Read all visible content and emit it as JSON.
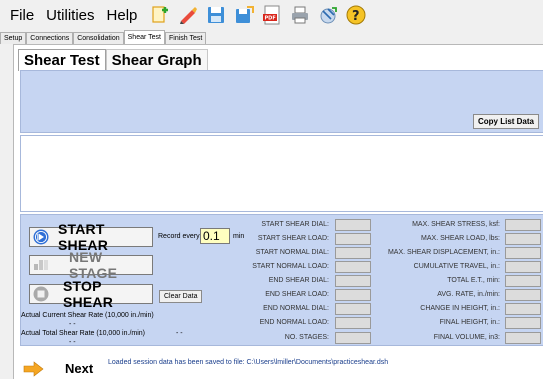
{
  "menu": {
    "items": [
      "File",
      "Utilities",
      "Help"
    ]
  },
  "toolbar_icons": [
    "new-icon",
    "edit-icon",
    "save-icon",
    "save-as-icon",
    "pdf-icon",
    "print-icon",
    "export-icon",
    "help-icon"
  ],
  "outer_tabs": [
    "Setup",
    "Connections",
    "Consolidation",
    "Shear Test",
    "Finish Test"
  ],
  "outer_active": "Shear Test",
  "inner_tabs": [
    "Shear Test",
    "Shear Graph"
  ],
  "copy_list_label": "Copy List Data",
  "controls": {
    "start_label": "START SHEAR",
    "new_stage_label": "NEW STAGE",
    "stop_label": "STOP SHEAR",
    "record_every_label": "Record every",
    "record_value": "0.1",
    "record_unit": "min",
    "clear_label": "Clear Data",
    "current_rate_label": "Actual Current Shear Rate (10,000 in./min)",
    "current_rate_value": "- -",
    "total_rate_label": "Actual Total Shear Rate (10,000 in./min)",
    "total_rate_value": "- -",
    "total_rate_value2": "- -"
  },
  "left_fields": [
    "START SHEAR DIAL:",
    "START SHEAR LOAD:",
    "START NORMAL DIAL:",
    "START NORMAL LOAD:",
    "END SHEAR DIAL:",
    "END SHEAR LOAD:",
    "END NORMAL DIAL:",
    "END NORMAL LOAD:",
    "NO. STAGES:"
  ],
  "right_fields": [
    "MAX. SHEAR STRESS, ksf:",
    "MAX. SHEAR LOAD, lbs:",
    "MAX. SHEAR DISPLACEMENT, in.:",
    "CUMULATIVE TRAVEL, in.:",
    "TOTAL E.T., min:",
    "AVG. RATE, in./min:",
    "CHANGE IN HEIGHT, in.:",
    "FINAL HEIGHT, in.:",
    "FINAL VOLUME, in3:"
  ],
  "next_label": "Next",
  "status_message": "Loaded session data has been saved to file: C:\\Users\\lmiller\\Documents\\practiceshear.dsh",
  "colors": {
    "panel_blue": "#c6d5f2",
    "input_yellow": "#ffffc0",
    "start_icon_blue": "#2f6fd6",
    "next_arrow_orange": "#f5a623"
  }
}
